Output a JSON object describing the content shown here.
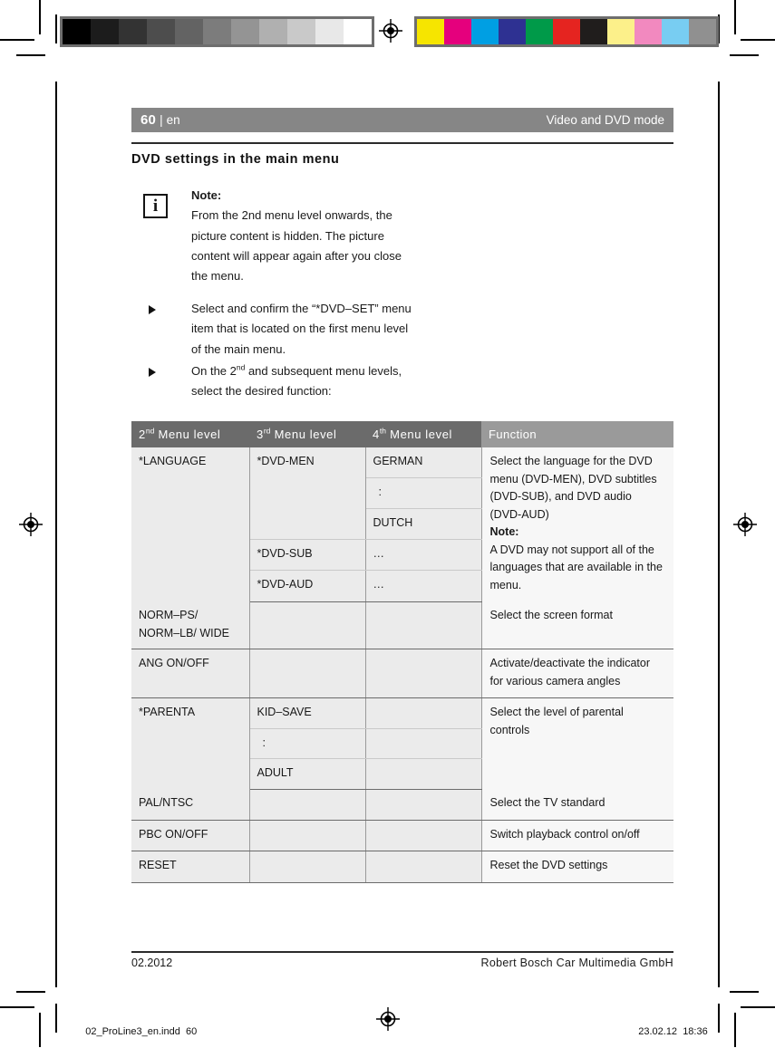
{
  "page_header": {
    "page_number": "60",
    "separator": "|",
    "language": "en",
    "section": "Video and DVD mode"
  },
  "section_title": "DVD settings in the main menu",
  "note": {
    "icon": "info-icon",
    "icon_glyph": "i",
    "label": "Note:",
    "text": "From the 2nd menu level onwards, the picture content is hidden. The picture content will appear again after you close the menu."
  },
  "steps": [
    {
      "bullet": "triangle-bullet-icon",
      "text": "Select and confirm the “*DVD–SET” menu item that is located on the first menu level of the main menu."
    },
    {
      "bullet": "triangle-bullet-icon",
      "text_before": "On the 2",
      "sup": "nd",
      "text_after": " and subsequent menu levels, select the desired function:"
    }
  ],
  "table": {
    "headers": [
      {
        "prefix": "2",
        "sup": "nd",
        "suffix": " Menu level"
      },
      {
        "prefix": "3",
        "sup": "rd",
        "suffix": " Menu level"
      },
      {
        "prefix": "4",
        "sup": "th",
        "suffix": " Menu level"
      },
      {
        "prefix": "Function",
        "sup": "",
        "suffix": ""
      }
    ],
    "rows": [
      {
        "level2": "*LANGUAGE",
        "level3": "*DVD-MEN",
        "level4": "GERMAN",
        "function": "Select the language for the DVD menu (DVD-MEN), DVD subtitles (DVD-SUB), and DVD audio (DVD-AUD)",
        "function_note_label": "Note:",
        "function_note_text": "A DVD may not support all of the languages that are available in the menu."
      },
      {
        "level4": ":"
      },
      {
        "level4": "DUTCH"
      },
      {
        "level3": "*DVD-SUB",
        "level4": "…"
      },
      {
        "level3": "*DVD-AUD",
        "level4": "…"
      },
      {
        "level2": "NORM–PS/ NORM–LB/ WIDE",
        "level2_line1": "NORM–PS/",
        "level2_line2": "NORM–LB/ WIDE",
        "function": "Select the screen format"
      },
      {
        "level2": "ANG ON/OFF",
        "function": "Activate/deactivate the indicator for various camera angles"
      },
      {
        "level2": "*PARENTA",
        "level3": "KID–SAVE",
        "function": "Select the level of parental controls"
      },
      {
        "level3": ":"
      },
      {
        "level3": "ADULT"
      },
      {
        "level2": "PAL/NTSC",
        "function": "Select the TV standard"
      },
      {
        "level2": "PBC ON/OFF",
        "function": "Switch playback control on/off"
      },
      {
        "level2": "RESET",
        "function": "Reset the DVD settings"
      }
    ]
  },
  "page_footer": {
    "date": "02.2012",
    "company": "Robert Bosch Car Multimedia GmbH"
  },
  "slug": {
    "filename": "02_ProLine3_en.indd",
    "page": "60",
    "date": "23.02.12",
    "time": "18:36",
    "registration_icon": "registration-target-icon"
  },
  "calibration": {
    "grayscale_label": "grayscale-step-wedge",
    "grayscale": [
      "#000000",
      "#1c1c1c",
      "#333333",
      "#4d4d4d",
      "#636363",
      "#7c7c7c",
      "#949494",
      "#b0b0b0",
      "#c9c9c9",
      "#e8e8e8",
      "#ffffff"
    ],
    "color_label": "process-color-bar",
    "colors": [
      "#f6e500",
      "#e5007d",
      "#009fe3",
      "#2e3192",
      "#009a49",
      "#e52420",
      "#201d1c",
      "#fcf08a",
      "#f289bf",
      "#78cdf2",
      "#909090"
    ]
  },
  "marks": {
    "registration_icon": "registration-target-icon",
    "crop_mark": "crop-mark"
  },
  "colors": {
    "header_bar": "#868686",
    "table_header": "#6b6b6b",
    "table_header_function": "#9a9a9a",
    "table_cell": "#ebebeb",
    "table_cell_function": "#f7f7f7",
    "rule": "#2b2b2b"
  }
}
